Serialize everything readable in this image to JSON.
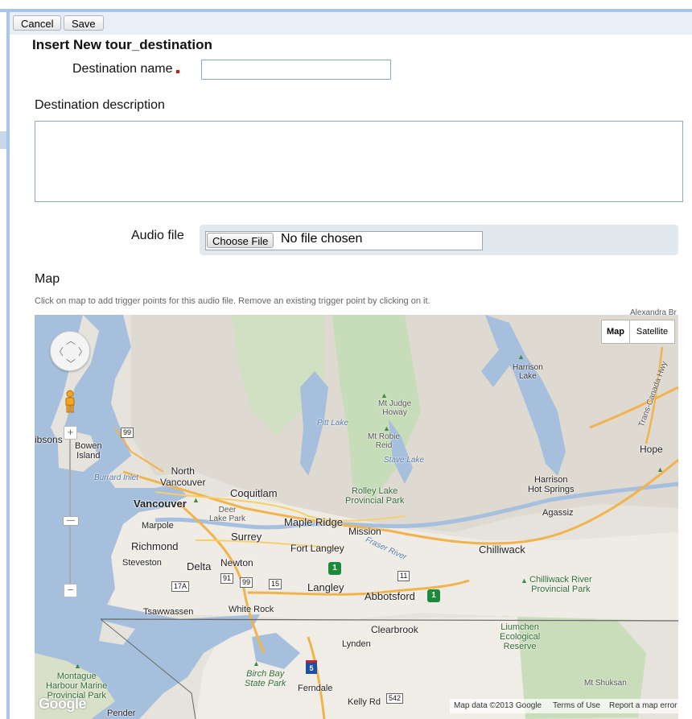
{
  "toolbar": {
    "cancel_label": "Cancel",
    "save_label": "Save"
  },
  "form": {
    "title": "Insert New tour_destination",
    "destination_name_label": "Destination name",
    "destination_name_value": "",
    "description_label": "Destination description",
    "description_value": "",
    "audio_label": "Audio file",
    "choose_file_label": "Choose File",
    "no_file_text": "No file chosen",
    "map_label": "Map",
    "map_help": "Click on map to add trigger points for this audio file. Remove an existing trigger point by clicking on it."
  },
  "map": {
    "type_buttons": {
      "map": "Map",
      "satellite": "Satellite"
    },
    "places": {
      "alexandra": "Alexandra Br",
      "harrison_lake": "Harrison\nLake",
      "trans_canada": "Trans-Canada Hwy",
      "mt_judge_howay": "Mt Judge\nHoway",
      "pitt_lake": "Pitt Lake",
      "mt_robie_reid": "Mt Robie\nReid",
      "stave_lake": "Stave Lake",
      "gibsons": "ibsons",
      "bowen_island": "Bowen\nIsland",
      "hope": "Hope",
      "burrard_inlet": "Burrard Inlet",
      "north_vancouver": "North\nVancouver",
      "harrison_hot_springs": "Harrison\nHot Springs",
      "rolley_lake": "Rolley Lake\nProvincial Park",
      "coquitlam": "Coquitlam",
      "vancouver": "Vancouver",
      "deer_lake_park": "Deer\nLake Park",
      "agassiz": "Agassiz",
      "marpole": "Marpole",
      "surrey": "Surrey",
      "maple_ridge": "Maple Ridge",
      "mission": "Mission",
      "richmond": "Richmond",
      "fort_langley": "Fort Langley",
      "chilliwack": "Chilliwack",
      "fraser_river": "Fraser River",
      "steveston": "Steveston",
      "delta": "Delta",
      "newton": "Newton",
      "langley": "Langley",
      "abbotsford": "Abbotsford",
      "chilliwack_river": "Chilliwack River\nProvincial Park",
      "tsawwassen": "Tsawwassen",
      "white_rock": "White Rock",
      "clearbrook": "Clearbrook",
      "liumchen": "Liumchen\nEcological\nReserve",
      "lynden": "Lynden",
      "birch_bay": "Birch Bay\nState Park",
      "montague": "Montague\nHarbour Marine\nProvincial Park",
      "ferndale": "Ferndale",
      "mt_shuksan": "Mt Shuksan",
      "kelly_rd": "Kelly Rd",
      "pender": "Pender"
    },
    "shields": {
      "r99a": "99",
      "r99b": "99",
      "r91": "91",
      "r15": "15",
      "r17a": "17A",
      "r11": "11",
      "r542": "542",
      "tc1": "1",
      "tc1b": "1",
      "i5": "5"
    },
    "google_logo": "Google",
    "attribution": {
      "data": "Map data ©2013 Google",
      "terms": "Terms of Use",
      "report": "Report a map error"
    }
  }
}
